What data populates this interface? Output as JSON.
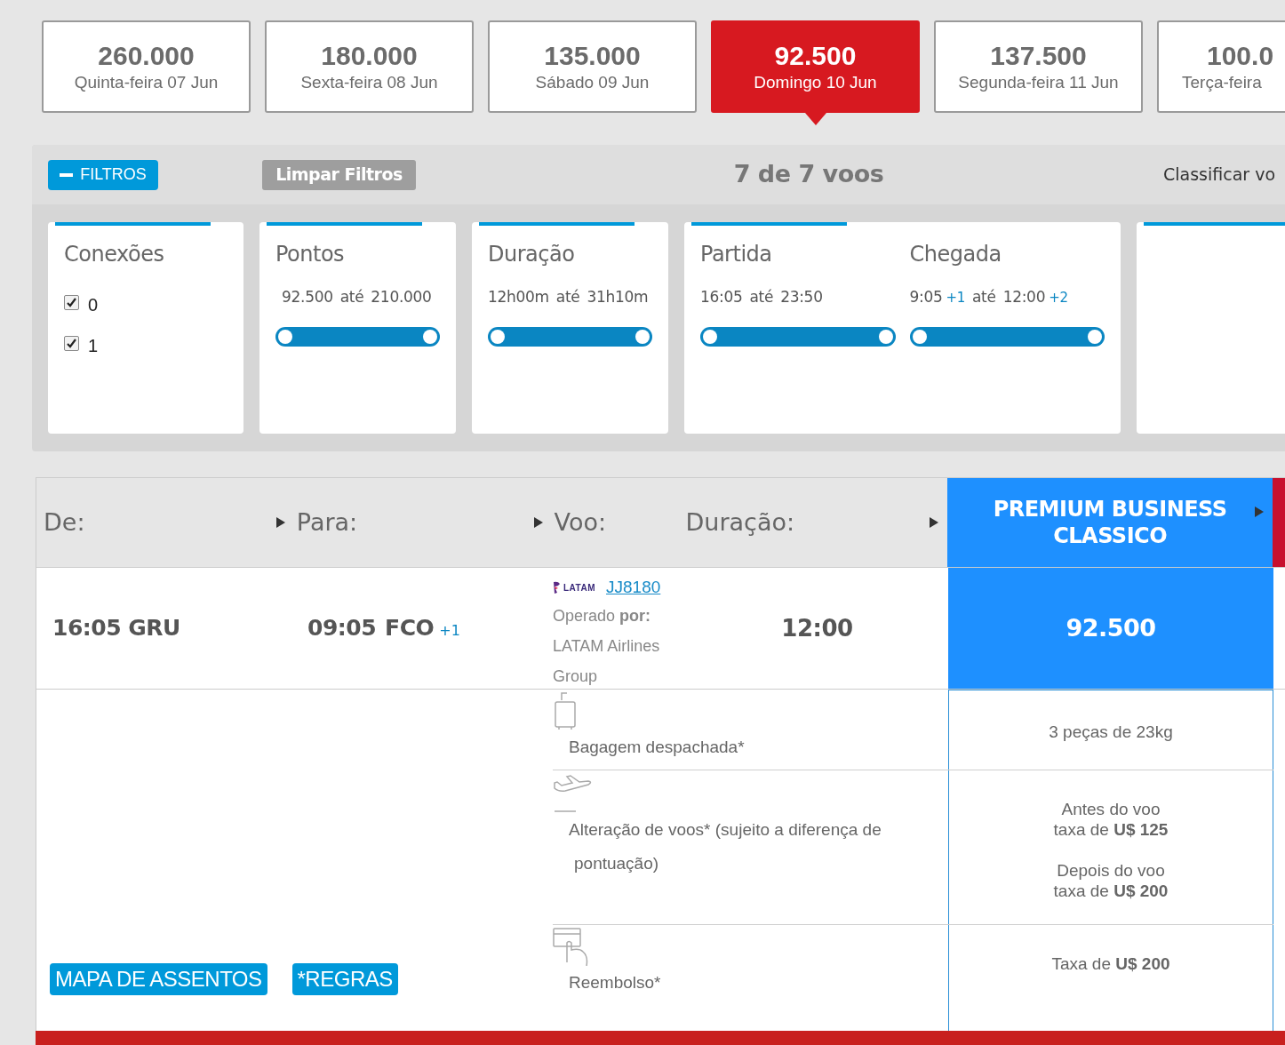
{
  "dates": [
    {
      "price": "260.000",
      "day": "Quinta-feira 07 Jun",
      "selected": false
    },
    {
      "price": "180.000",
      "day": "Sexta-feira 08 Jun",
      "selected": false
    },
    {
      "price": "135.000",
      "day": "Sábado 09 Jun",
      "selected": false
    },
    {
      "price": "92.500",
      "day": "Domingo 10 Jun",
      "selected": true
    },
    {
      "price": "137.500",
      "day": "Segunda-feira 11 Jun",
      "selected": false
    },
    {
      "price": "100.0",
      "day": "Terça-feira",
      "selected": false
    }
  ],
  "filter_bar": {
    "toggle": "FILTROS",
    "expanded": true,
    "clear": "Limpar Filtros",
    "count": "7 de 7 voos",
    "sort": "Classificar vo"
  },
  "filters": [
    {
      "kind": "checkboxes",
      "sections": [
        {
          "title": "Conexões",
          "options": [
            {
              "label": "0",
              "checked": true
            },
            {
              "label": "1",
              "checked": true
            }
          ]
        }
      ]
    },
    {
      "kind": "range",
      "sections": [
        {
          "title": "Pontos",
          "from": "92.500",
          "sep": "até",
          "to": "210.000",
          "level": 1
        }
      ]
    },
    {
      "kind": "range",
      "sections": [
        {
          "title": "Duração",
          "from": "12h00m",
          "sep": "até",
          "to": "31h10m",
          "level": 1
        }
      ]
    },
    {
      "kind": "range",
      "sections": [
        {
          "title": "Partida",
          "from": "16:05",
          "sep": "até",
          "to": "23:50",
          "level": 1
        },
        {
          "title": "Chegada",
          "from": "9:05",
          "from_extra": "+1",
          "sep": "até",
          "to": "12:00",
          "to_extra": "+2",
          "level": 1
        }
      ]
    },
    {
      "kind": "empty"
    }
  ],
  "table": {
    "columns": [
      "De:",
      "Para:",
      "Voo:",
      "Duração:"
    ],
    "fare_column": "PREMIUM BUSINESS CLASSICO",
    "flight": {
      "departure": "16:05 GRU",
      "arrival_time": "09:05",
      "arrival_airport": "FCO",
      "arrival_extra": "+1",
      "airline_logo": "LATAM",
      "flight_number": "JJ8180",
      "operator": "Operado **por:** LATAM Airlines Group",
      "duration": "12:00",
      "price": "92.500"
    },
    "features": [
      {
        "kind": "baggage",
        "label": "Bagagem despachada*",
        "value": [
          [
            "3 peças de 23kg"
          ]
        ]
      },
      {
        "kind": "change",
        "label": "Alteração de voos* (sujeito a diferença de pontuação)",
        "value": [
          [
            "Antes do voo",
            "taxa de **U$ 125**"
          ],
          [
            "Depois do voo",
            "taxa de **U$ 200**"
          ]
        ]
      },
      {
        "kind": "refund",
        "label": "Reembolso*",
        "value": [
          [
            "Taxa de **U$ 200**"
          ]
        ]
      }
    ],
    "buttons": [
      "MAPA DE ASSENTOS",
      "*REGRAS"
    ]
  }
}
